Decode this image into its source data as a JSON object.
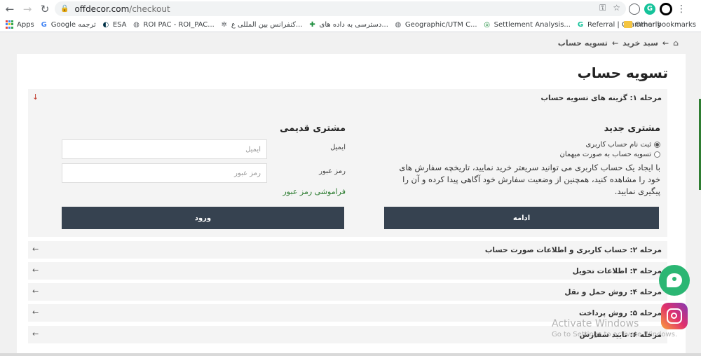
{
  "browser": {
    "url_host": "offdecor.com",
    "url_path": "/checkout",
    "bookmarks": [
      {
        "label": "Apps",
        "icon": "apps-grid-icon"
      },
      {
        "label": "Google ترجمه",
        "icon": "google-translate-icon"
      },
      {
        "label": "ESA",
        "icon": "esa-icon"
      },
      {
        "label": "ROI PAC - ROI_PAC...",
        "icon": "globe-icon"
      },
      {
        "label": "کنفرانس بین المللی ع...",
        "icon": "gear-icon"
      },
      {
        "label": "دسترسی به داده های...",
        "icon": "plus-icon"
      },
      {
        "label": "Geographic/UTM C...",
        "icon": "globe-icon"
      },
      {
        "label": "Settlement Analysis...",
        "icon": "settlement-icon"
      },
      {
        "label": "Referral | Grammarly",
        "icon": "grammarly-icon"
      }
    ],
    "other_bookmarks": "Other bookmarks",
    "extension_letter": "G"
  },
  "breadcrumb": {
    "items": [
      "سبد خرید",
      "تسویه حساب"
    ],
    "separator": "←"
  },
  "page_title": "تسویه حساب",
  "steps": [
    {
      "label": "مرحله ۱: گزینه های تسویه حساب",
      "arrow": "↓"
    },
    {
      "label": "مرحله ۲: حساب کاربری و اطلاعات صورت حساب",
      "arrow": "←"
    },
    {
      "label": "مرحله ۳: اطلاعات تحویل",
      "arrow": "←"
    },
    {
      "label": "مرحله ۴: روش حمل و نقل",
      "arrow": "←"
    },
    {
      "label": "مرحله ۵: روش پرداخت",
      "arrow": "←"
    },
    {
      "label": "مرحله ۶: تایید سفارش",
      "arrow": "←"
    }
  ],
  "new_customer": {
    "title": "مشتری جدید",
    "options": [
      "ثبت نام حساب کاربری",
      "تسویه حساب به صورت میهمان"
    ],
    "selected_option": 0,
    "description": "با ایجاد یک حساب کاربری می توانید سریعتر خرید نمایید، تاریخچه سفارش های خود را مشاهده کنید، همچنین از وضعیت سفارش خود آگاهی پیدا کرده و آن را پیگیری نمایید.",
    "continue_label": "ادامه"
  },
  "returning_customer": {
    "title": "مشتری قدیمی",
    "email_label": "ایمیل",
    "email_placeholder": "ایمیل",
    "password_label": "رمز عبور",
    "password_placeholder": "رمز عبور",
    "forgot_label": "فراموشی رمز عبور",
    "login_label": "ورود"
  },
  "watermark": {
    "line1": "Activate Windows",
    "line2": "Go to Settings to activate Windows."
  },
  "colors": {
    "button_bg": "#364250",
    "link_green": "#2e7d32",
    "chat_green": "#2bb673"
  }
}
